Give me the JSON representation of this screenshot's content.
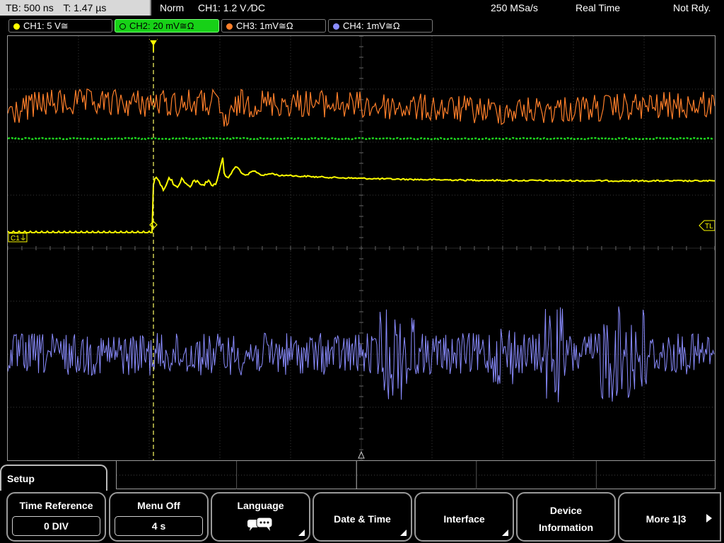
{
  "status": {
    "timebase": "TB: 500 ns",
    "trigger_time": "T: 1.47 µs",
    "mode": "Norm",
    "trigger_info": "CH1: 1.2 V ∕DC",
    "sample_rate": "250 MSa/s",
    "acq_mode": "Real Time",
    "ready_state": "Not Rdy."
  },
  "channels": [
    {
      "label": "CH1: 5 V≅",
      "color": "#ffff00"
    },
    {
      "label": "CH2: 20 mV≅Ω",
      "color": "#1fd81f"
    },
    {
      "label": "CH3: 1mV≅Ω",
      "color": "#ff7f2a"
    },
    {
      "label": "CH4: 1mV≅Ω",
      "color": "#8a8cff"
    }
  ],
  "markers": {
    "ch1_ground": "C1⏚",
    "trigger_level": "TL",
    "trigger_position": "T"
  },
  "menu": {
    "title": "Setup",
    "softkeys": [
      {
        "label": "Time Reference",
        "value": "0 DIV"
      },
      {
        "label": "Menu Off",
        "value": "4 s"
      },
      {
        "label": "Language",
        "icon": "speech-bubbles-icon"
      },
      {
        "label": "Date & Time"
      },
      {
        "label": "Interface"
      },
      {
        "label_line1": "Device",
        "label_line2": "Information"
      },
      {
        "label": "More 1|3"
      }
    ]
  }
}
